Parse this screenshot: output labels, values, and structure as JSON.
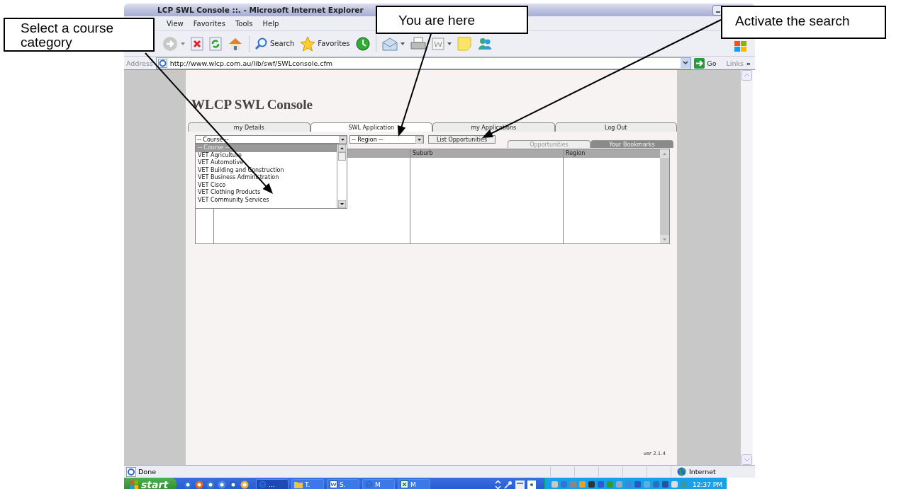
{
  "callouts": [
    {
      "text": "Select a course category"
    },
    {
      "text": "You are here"
    },
    {
      "text": "Activate the search"
    }
  ],
  "window": {
    "title": "LCP SWL Console ::. - Microsoft Internet Explorer"
  },
  "menu": [
    "View",
    "Favorites",
    "Tools",
    "Help"
  ],
  "toolbar": {
    "search": "Search",
    "favorites": "Favorites"
  },
  "address": {
    "label": "Address",
    "url": "http://www.wlcp.com.au/lib/swf/SWLconsole.cfm",
    "go": "Go",
    "links": "Links",
    "more": "»"
  },
  "page": {
    "heading": "WLCP SWL Console",
    "tabs": [
      {
        "label": "my Details",
        "selected": false
      },
      {
        "label": "SWL Application",
        "selected": true
      },
      {
        "label": "my Applications",
        "selected": false
      },
      {
        "label": "Log Out",
        "selected": false
      }
    ],
    "course_select": {
      "value": "-- Course --",
      "expanded": true,
      "options": [
        {
          "label": "-- Course --",
          "selected": true
        },
        {
          "label": "VET Agriculture",
          "selected": false
        },
        {
          "label": "VET Automotive",
          "selected": false
        },
        {
          "label": "VET Building and Construction",
          "selected": false
        },
        {
          "label": "VET Business Administration",
          "selected": false
        },
        {
          "label": "VET Cisco",
          "selected": false
        },
        {
          "label": "VET Clothing Products",
          "selected": false
        },
        {
          "label": "VET Community Services",
          "selected": false
        }
      ]
    },
    "region_select": {
      "value": "-- Region --"
    },
    "list_button": "List Opportunities",
    "view_tabs": [
      {
        "label": "Opportunities",
        "selected": true
      },
      {
        "label": "Your Bookmarks",
        "selected": false
      }
    ],
    "columns": [
      "Suburb",
      "Region"
    ],
    "version": "ver 2.1.4"
  },
  "status_bar": {
    "text": "Done",
    "zone": "Internet"
  },
  "taskbar": {
    "start": "start",
    "tasks": [
      {
        "label": "...",
        "kind": "ie",
        "selected": true
      },
      {
        "label": "T.",
        "kind": "folder",
        "selected": false
      },
      {
        "label": "S.",
        "kind": "word",
        "selected": false
      },
      {
        "label": "M",
        "kind": "ie",
        "selected": false
      },
      {
        "label": "M",
        "kind": "excel",
        "selected": false
      }
    ],
    "clock": "12:37 PM"
  }
}
